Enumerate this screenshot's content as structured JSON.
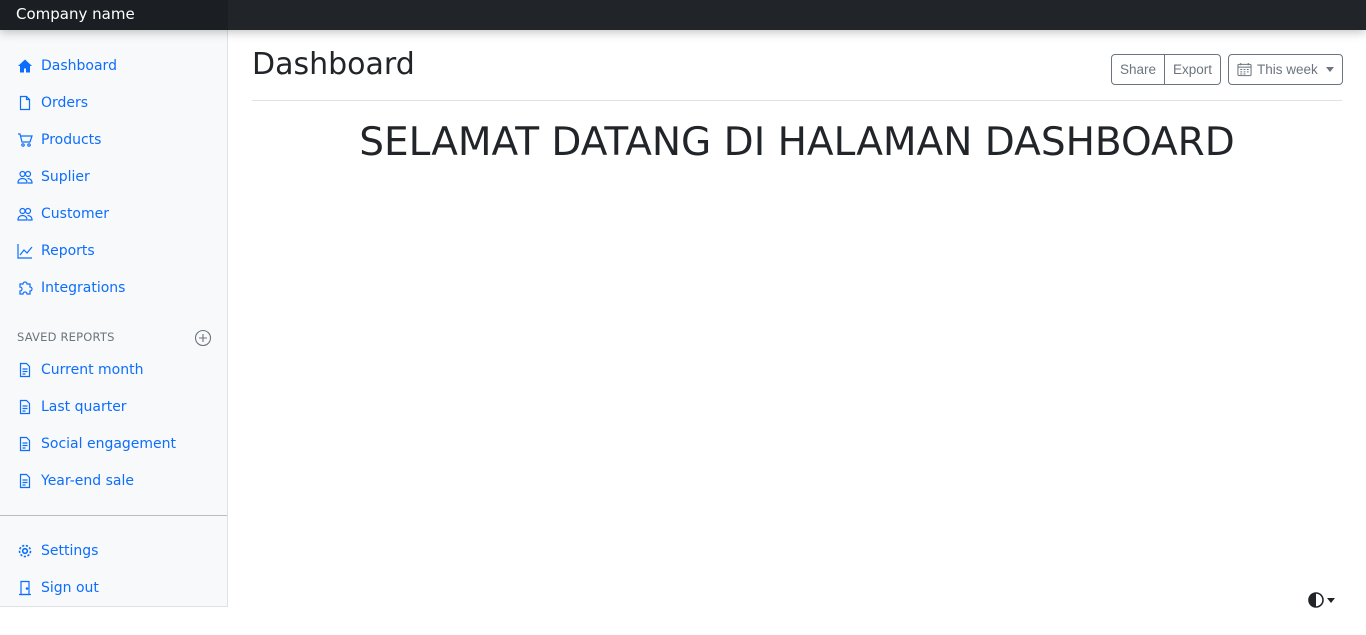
{
  "navbar": {
    "brand": "Company name"
  },
  "sidebar": {
    "items": [
      {
        "label": "Dashboard",
        "icon": "house-icon"
      },
      {
        "label": "Orders",
        "icon": "file-icon"
      },
      {
        "label": "Products",
        "icon": "cart-icon"
      },
      {
        "label": "Suplier",
        "icon": "people-icon"
      },
      {
        "label": "Customer",
        "icon": "people-icon"
      },
      {
        "label": "Reports",
        "icon": "graph-icon"
      },
      {
        "label": "Integrations",
        "icon": "puzzle-icon"
      }
    ],
    "saved_reports_title": "SAVED REPORTS",
    "saved_reports": [
      {
        "label": "Current month",
        "icon": "file-text-icon"
      },
      {
        "label": "Last quarter",
        "icon": "file-text-icon"
      },
      {
        "label": "Social engagement",
        "icon": "file-text-icon"
      },
      {
        "label": "Year-end sale",
        "icon": "file-text-icon"
      }
    ],
    "bottom": [
      {
        "label": "Settings",
        "icon": "gear-icon"
      },
      {
        "label": "Sign out",
        "icon": "door-icon"
      }
    ]
  },
  "main": {
    "title": "Dashboard",
    "share_label": "Share",
    "export_label": "Export",
    "period_label": "This week",
    "welcome": "SELAMAT DATANG DI HALAMAN DASHBOARD"
  },
  "colors": {
    "accent": "#0d6efd",
    "navbar": "#212529",
    "sidebar_bg": "#f8f9fa"
  }
}
